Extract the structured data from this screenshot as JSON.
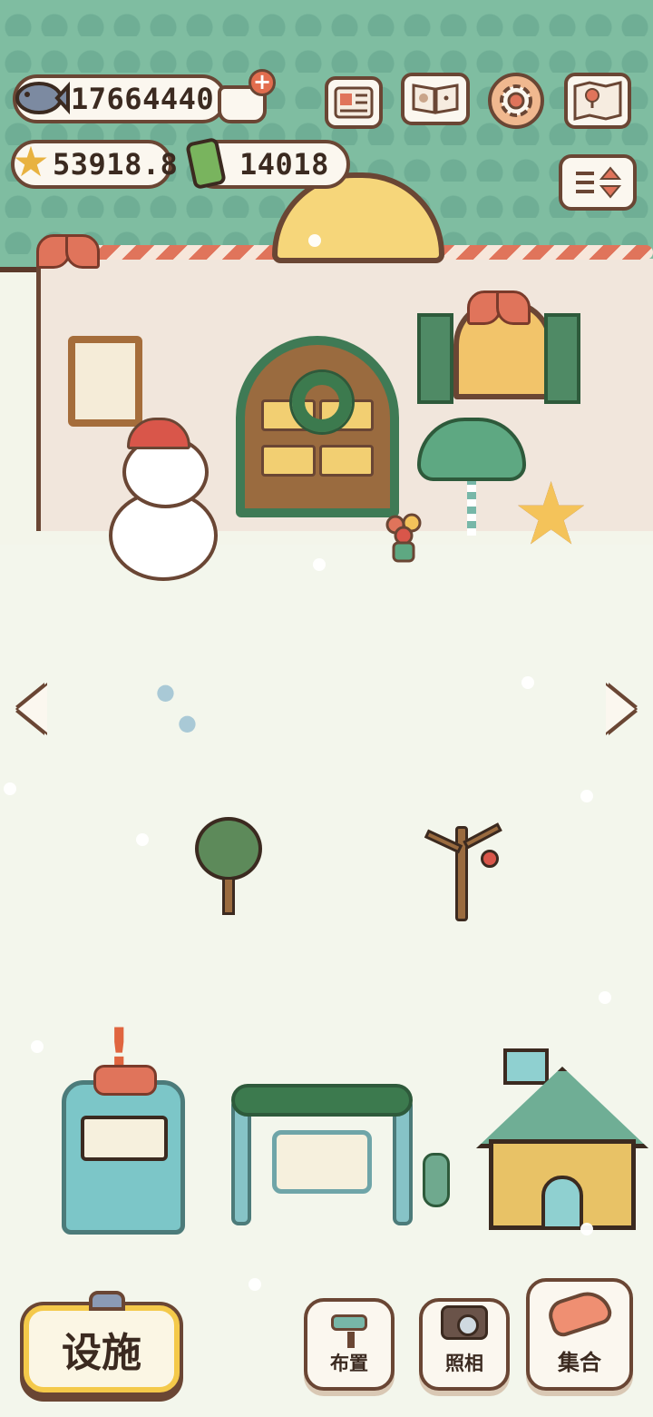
{
  "hud": {
    "fish_currency": "17664440",
    "star_currency": "53918.8",
    "battery_currency": "14018",
    "icons": [
      "fish-icon",
      "cart-plus-icon",
      "star-icon",
      "battery-icon",
      "news-icon",
      "paw-book-icon",
      "gear-icon",
      "map-icon",
      "compare-arrows-icon"
    ]
  },
  "bottom_bar": {
    "facility_label": "设施",
    "layout_label": "布置",
    "photo_label": "照相",
    "gather_label": "集合"
  },
  "scene": {
    "alert_mark": "!"
  },
  "colors": {
    "accent_yellow": "#f4c94a",
    "outline_brown": "#6a4634",
    "roof_green": "#7fbda1",
    "ribbon_red": "#e0745b",
    "snow": "#f3f6ec"
  }
}
